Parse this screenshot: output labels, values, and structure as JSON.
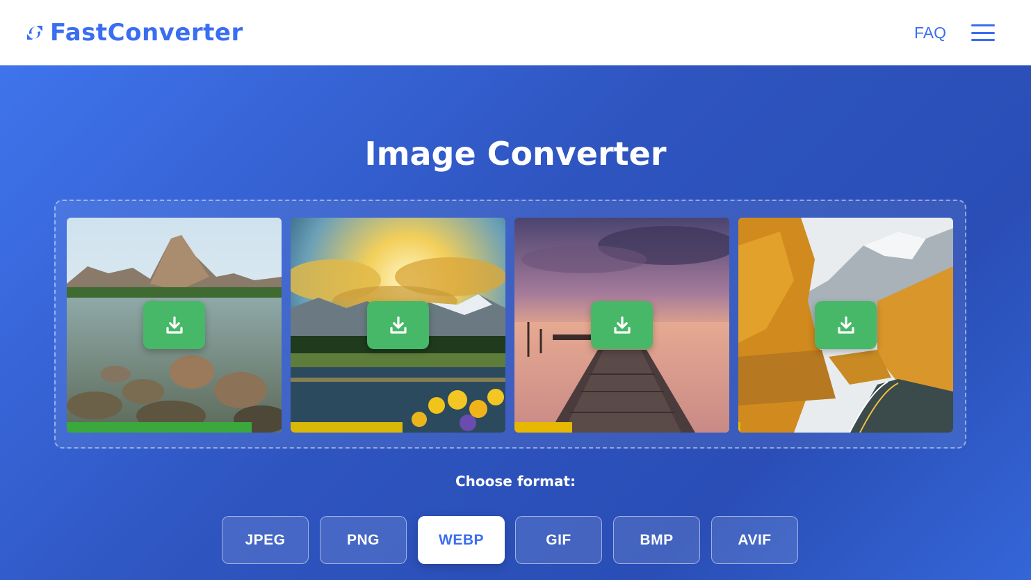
{
  "header": {
    "brand": "FastConverter",
    "faq_label": "FAQ"
  },
  "main": {
    "title": "Image Converter",
    "images": [
      {
        "scene": "mountain lake with rocks",
        "progress": 0.86,
        "progress_color": "#3aa83c"
      },
      {
        "scene": "sunrise over mountains and lake with sunflowers",
        "progress": 0.52,
        "progress_color": "#d9b807"
      },
      {
        "scene": "wooden pier at sunset",
        "progress": 0.27,
        "progress_color": "#e6b800"
      },
      {
        "scene": "autumn road in mountains",
        "progress": 0.01,
        "progress_color": "#e6b800"
      }
    ],
    "format_label": "Choose format:",
    "formats": [
      "JPEG",
      "PNG",
      "WEBP",
      "GIF",
      "BMP",
      "AVIF"
    ],
    "selected_format": "WEBP"
  },
  "colors": {
    "brand": "#3a6ef0",
    "download_button": "#47b868",
    "background": "#2f57c4"
  },
  "icons": {
    "logo": "refresh-bolt-icon",
    "menu": "hamburger-menu-icon",
    "download": "download-icon"
  }
}
